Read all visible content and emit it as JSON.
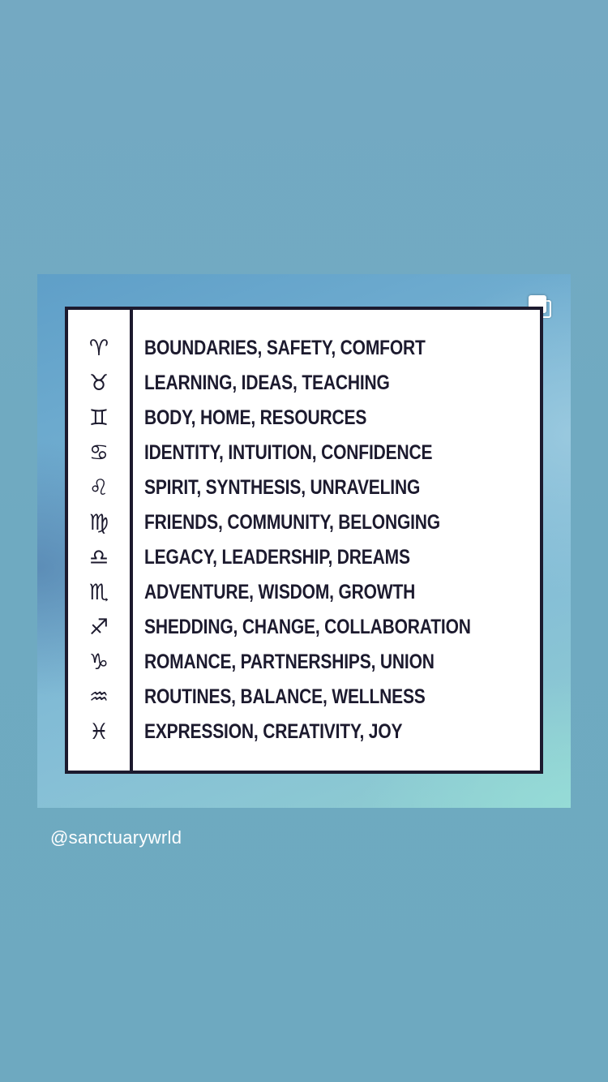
{
  "post": {
    "rows": [
      {
        "icon": "aries-icon",
        "glyph": "♈︎",
        "text": "BOUNDARIES, SAFETY, COMFORT"
      },
      {
        "icon": "taurus-icon",
        "glyph": "♉︎",
        "text": "LEARNING, IDEAS, TEACHING"
      },
      {
        "icon": "gemini-icon",
        "glyph": "♊︎",
        "text": "BODY, HOME, RESOURCES"
      },
      {
        "icon": "cancer-icon",
        "glyph": "♋︎",
        "text": "IDENTITY, INTUITION, CONFIDENCE"
      },
      {
        "icon": "leo-icon",
        "glyph": "♌︎",
        "text": "SPIRIT, SYNTHESIS, UNRAVELING"
      },
      {
        "icon": "virgo-icon",
        "glyph": "♍︎",
        "text": "FRIENDS, COMMUNITY, BELONGING"
      },
      {
        "icon": "libra-icon",
        "glyph": "♎︎",
        "text": "LEGACY, LEADERSHIP, DREAMS"
      },
      {
        "icon": "scorpio-icon",
        "glyph": "♏︎",
        "text": "ADVENTURE, WISDOM, GROWTH"
      },
      {
        "icon": "sagittarius-icon",
        "glyph": "♐︎",
        "text": "SHEDDING, CHANGE, COLLABORATION"
      },
      {
        "icon": "capricorn-icon",
        "glyph": "♑︎",
        "text": "ROMANCE, PARTNERSHIPS, UNION"
      },
      {
        "icon": "aquarius-icon",
        "glyph": "♒︎",
        "text": "ROUTINES, BALANCE, WELLNESS"
      },
      {
        "icon": "pisces-icon",
        "glyph": "♓︎",
        "text": "EXPRESSION, CREATIVITY, JOY"
      }
    ],
    "multi_icon": "multiple-images-icon"
  },
  "username": "@sanctuarywrld",
  "colors": {
    "background": "#6faac1",
    "ink": "#1c1a2e",
    "card": "#ffffff"
  }
}
